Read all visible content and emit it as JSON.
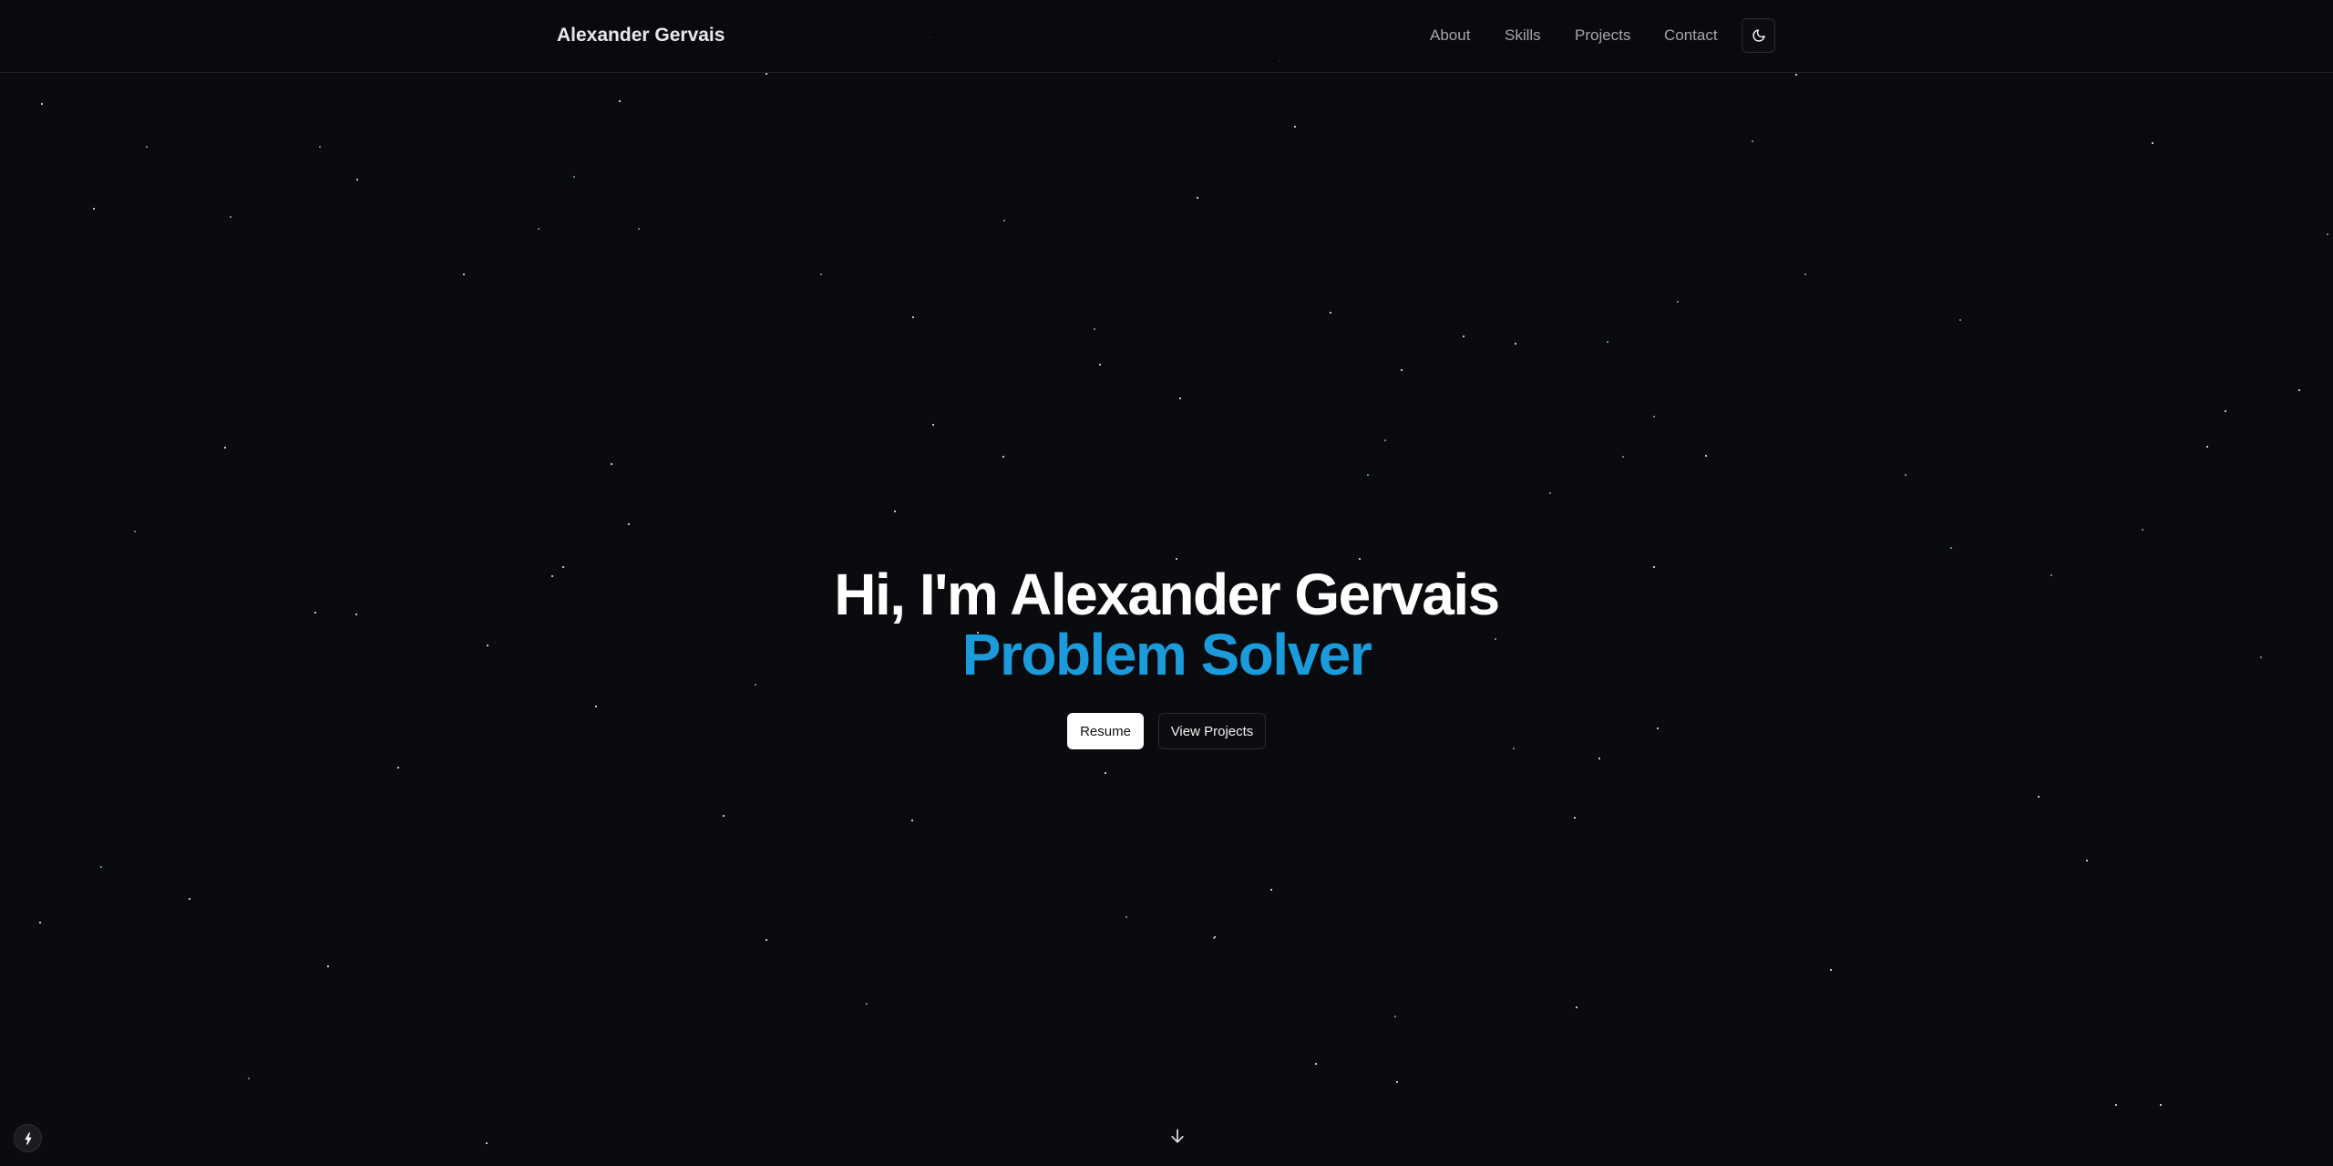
{
  "header": {
    "brand": "Alexander Gervais",
    "nav": [
      {
        "label": "About"
      },
      {
        "label": "Skills"
      },
      {
        "label": "Projects"
      },
      {
        "label": "Contact"
      }
    ],
    "theme_toggle_icon": "moon-icon"
  },
  "hero": {
    "title": "Hi, I'm Alexander Gervais",
    "subtitle": "Problem Solver",
    "buttons": {
      "resume": "Resume",
      "view_projects": "View Projects"
    }
  },
  "footer": {
    "scroll_icon": "arrow-down-icon",
    "badge_icon": "lightning-icon"
  },
  "colors": {
    "background": "#0a0b0e",
    "accent": "#1b9bdb",
    "nav_text": "#a3a6ad"
  }
}
